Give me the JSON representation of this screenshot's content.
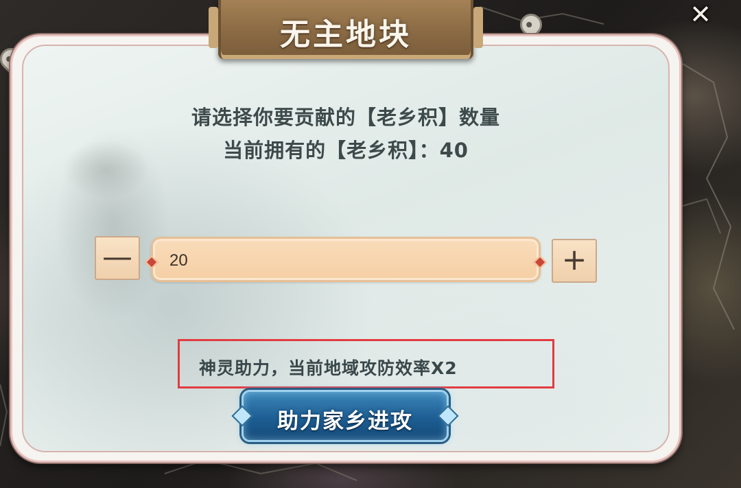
{
  "dialog": {
    "title": "无主地块",
    "prompt_line1": "请选择你要贡献的【老乡积】数量",
    "prompt_line2": "当前拥有的【老乡积】：40",
    "close_label": "✕"
  },
  "stepper": {
    "minus_label": "—",
    "plus_label": "+",
    "value": "20"
  },
  "bonus": {
    "text": "神灵助力，当前地域攻防效率X2"
  },
  "action": {
    "label": "助力家乡进攻"
  },
  "colors": {
    "title_plaque": "#8a6a44",
    "highlight_border": "#e23b40",
    "action_button": "#1d5e93",
    "stepper_fill": "#f5cfa4"
  },
  "icons": [
    "close-icon",
    "map-pin-icon",
    "minus-icon",
    "plus-icon"
  ]
}
